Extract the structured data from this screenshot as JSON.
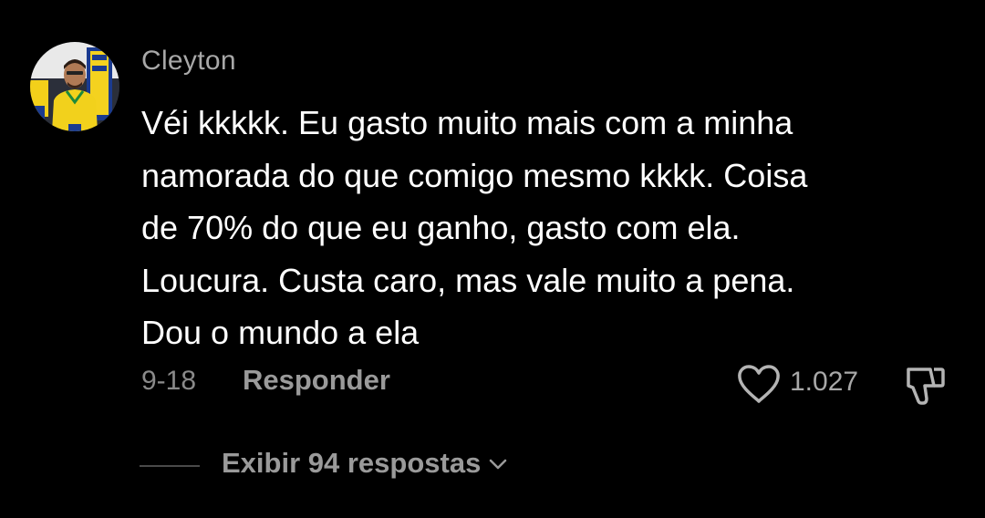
{
  "comment": {
    "username": "Cleyton",
    "text_lines": [
      "Véi kkkkk. Eu gasto muito mais com a minha",
      "namorada do que comigo mesmo kkkk. Coisa",
      "de 70% do que eu ganho, gasto com ela.",
      "Loucura. Custa caro, mas vale muito a pena.",
      "Dou o mundo a ela"
    ],
    "date": "9-18",
    "reply_label": "Responder",
    "like_count": "1.027",
    "view_replies_label": "Exibir 94 respostas"
  },
  "icons": {
    "like": "heart-outline-icon",
    "dislike": "thumbs-down-icon",
    "expand": "chevron-down-icon"
  },
  "colors": {
    "background": "#000000",
    "text": "#ffffff",
    "secondary_text": "#a8a8a8"
  }
}
